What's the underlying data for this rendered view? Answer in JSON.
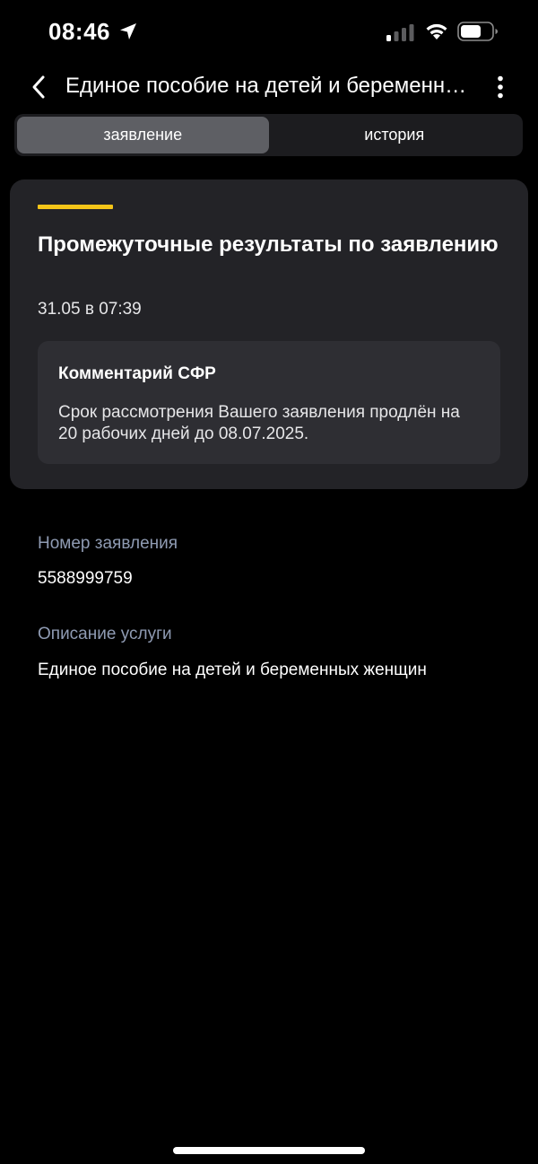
{
  "status_bar": {
    "time": "08:46",
    "icons": [
      "location-arrow-icon",
      "cellular-signal-icon",
      "wifi-icon",
      "battery-icon"
    ]
  },
  "header": {
    "title": "Единое пособие на детей и беременных женщин",
    "back_icon": "chevron-left-icon",
    "more_icon": "vertical-dots-icon"
  },
  "tabs": [
    {
      "label": "заявление",
      "active": true
    },
    {
      "label": "история",
      "active": false
    }
  ],
  "status_card": {
    "accent_color": "#f5c518",
    "title": "Промежуточные результаты по заявлению",
    "date": "31.05 в 07:39",
    "comment": {
      "title": "Комментарий СФР",
      "text": "Срок рассмотрения Вашего заявления продлён на 20 рабочих дней до 08.07.2025."
    }
  },
  "details": {
    "application_number_label": "Номер заявления",
    "application_number": "5588999759",
    "service_description_label": "Описание услуги",
    "service_description": "Единое пособие на детей и беременных женщин"
  },
  "colors": {
    "background": "#000000",
    "card": "#232327",
    "comment_box": "#2e2e33",
    "label": "#8f9bb3",
    "active_tab": "#5e5f64"
  }
}
